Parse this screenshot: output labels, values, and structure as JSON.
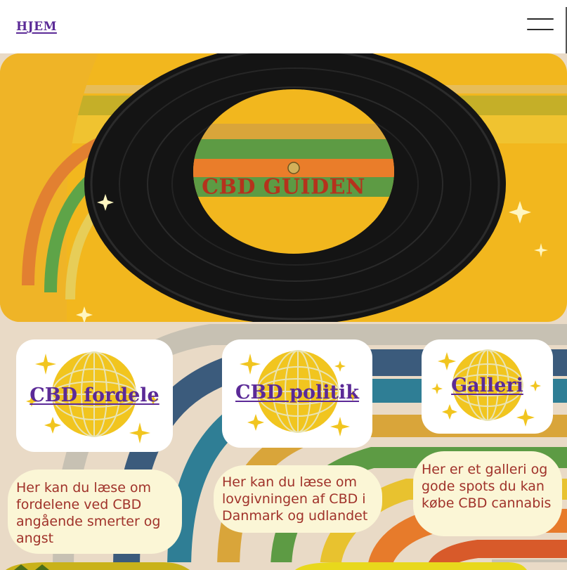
{
  "header": {
    "home_label": "HJEM",
    "menu_icon": "hamburger-menu-icon"
  },
  "hero": {
    "title": "CBD GUIDEN",
    "image": "vinyl-record-on-retro-rainbow-stripes"
  },
  "cards": [
    {
      "link_label": "CBD fordele",
      "image": "disco-ball-with-sparkles",
      "description": "Her kan du læse om fordelene ved CBD angående smerter og angst"
    },
    {
      "link_label": "CBD politik",
      "image": "disco-ball-with-sparkles",
      "description": "Her kan du læse om lovgivningen af CBD i Danmark og udlandet"
    },
    {
      "link_label": "Galleri",
      "image": "disco-ball-with-sparkles",
      "description": "Her er et galleri og gode spots du kan købe CBD cannabis"
    }
  ],
  "colors": {
    "link_purple": "#5b2a97",
    "hero_title_red": "#b5321c",
    "description_red": "#a0322a",
    "bubble_bg": "#fbf6d6",
    "page_bg": "#ebdcc8"
  }
}
